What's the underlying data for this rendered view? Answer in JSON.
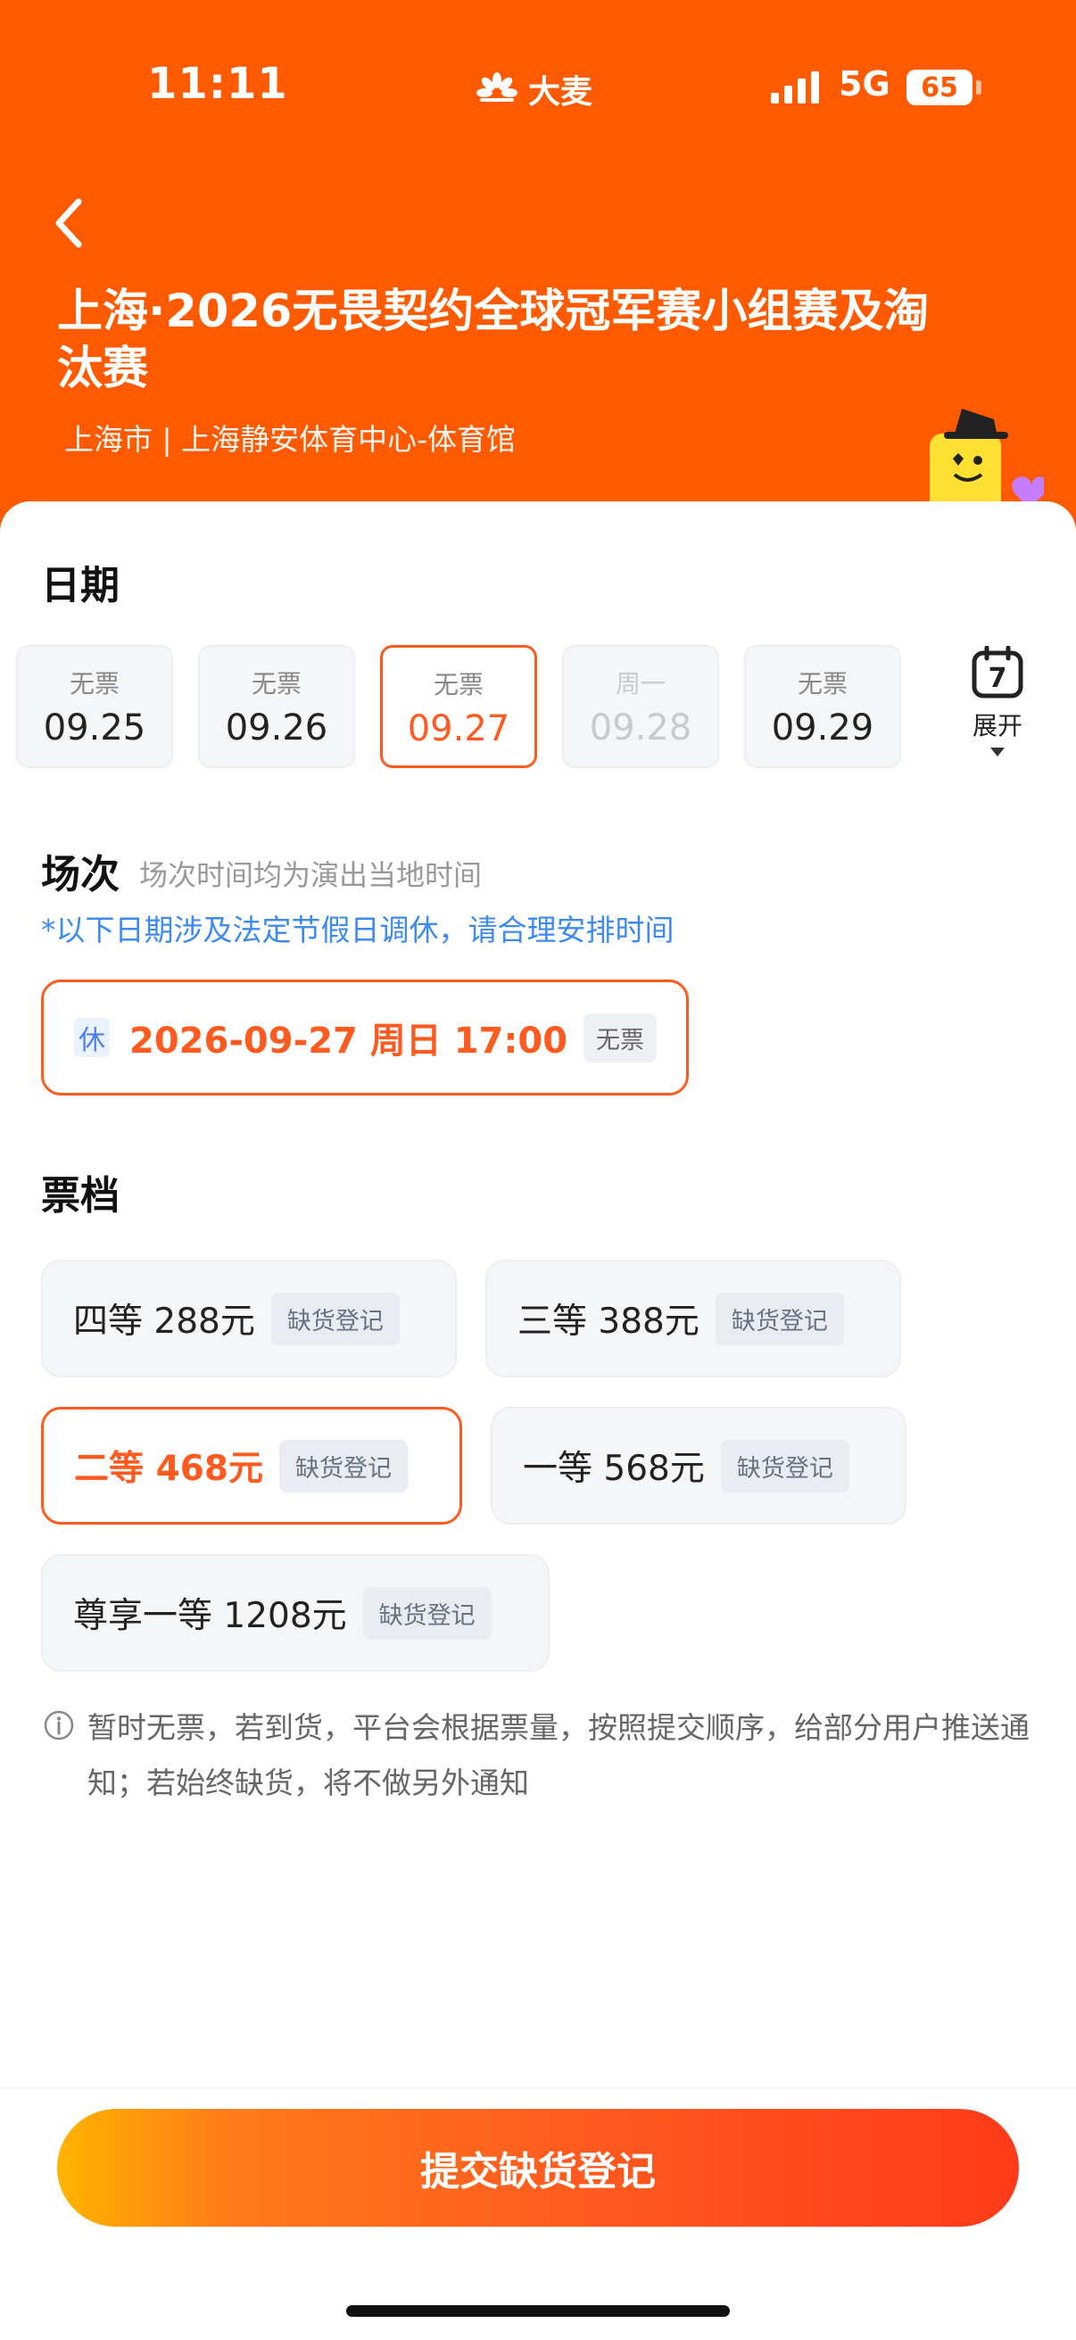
{
  "status_bar": {
    "time": "11:11",
    "brand": "大麦",
    "network": "5G",
    "battery": "65"
  },
  "header": {
    "title": "上海·2026无畏契约全球冠军赛小组赛及淘汰赛",
    "venue": "上海市 | 上海静安体育中心-体育馆"
  },
  "dates": {
    "heading": "日期",
    "items": [
      {
        "tag": "无票",
        "day": "09.25"
      },
      {
        "tag": "无票",
        "day": "09.26"
      },
      {
        "tag": "无票",
        "day": "09.27"
      },
      {
        "tag": "周一",
        "day": "09.28"
      },
      {
        "tag": "无票",
        "day": "09.29"
      }
    ],
    "calendar_day": "7",
    "expand_label": "展开"
  },
  "session": {
    "heading": "场次",
    "subtitle": "场次时间均为演出当地时间",
    "notice": "*以下日期涉及法定节假日调休，请合理安排时间",
    "rest_tag": "休",
    "text": "2026-09-27 周日 17:00",
    "badge": "无票"
  },
  "tiers": {
    "heading": "票档",
    "items": [
      {
        "name": "四等 288元",
        "badge": "缺货登记"
      },
      {
        "name": "三等 388元",
        "badge": "缺货登记"
      },
      {
        "name": "二等 468元",
        "badge": "缺货登记"
      },
      {
        "name": "一等 568元",
        "badge": "缺货登记"
      },
      {
        "name": "尊享一等 1208元",
        "badge": "缺货登记"
      }
    ]
  },
  "info_text": "暂时无票，若到货，平台会根据票量，按照提交顺序，给部分用户推送通知；若始终缺货，将不做另外通知",
  "submit_label": "提交缺货登记",
  "colors": {
    "brand_orange": "#ff5a00",
    "accent": "#ff5a1f",
    "notice_blue": "#3d8bf0"
  }
}
